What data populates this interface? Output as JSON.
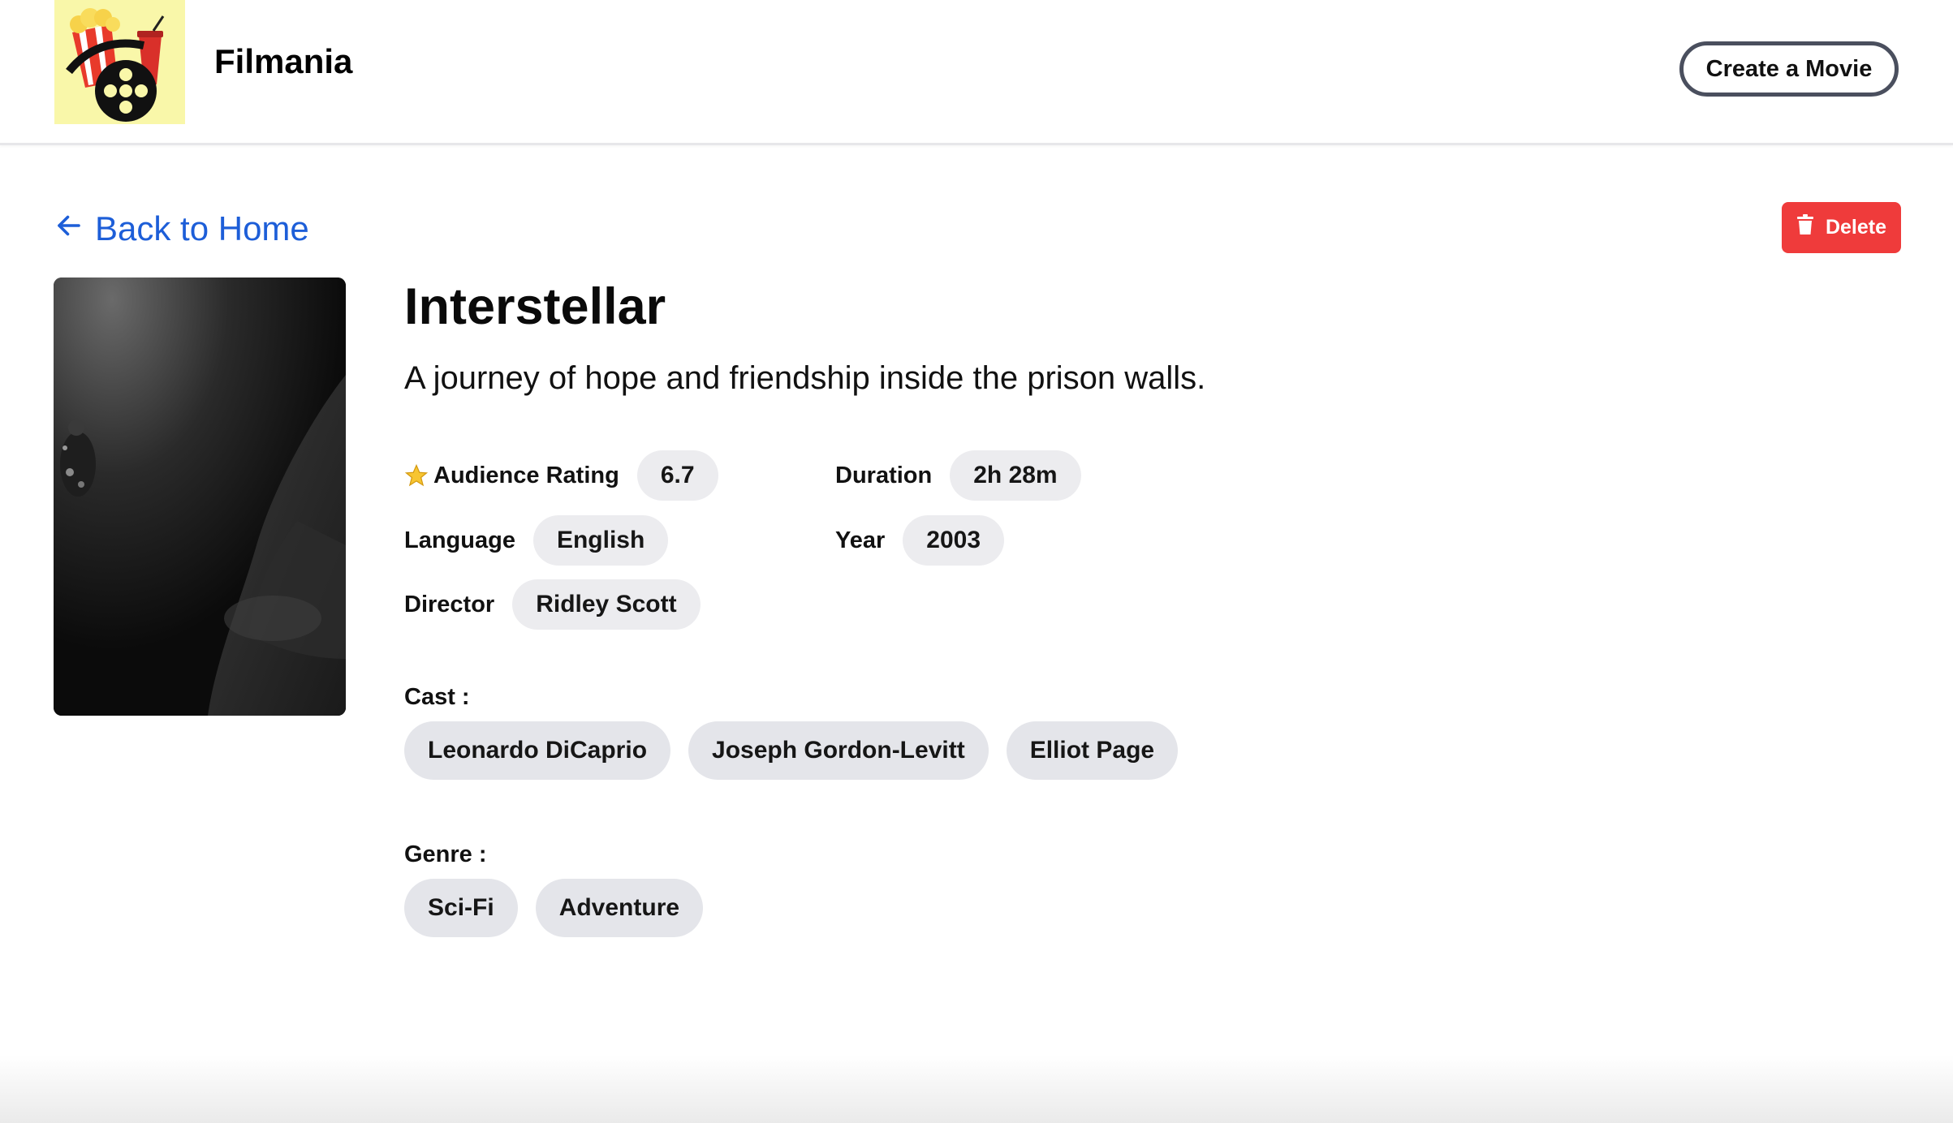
{
  "header": {
    "brand": "Filmania",
    "create_label": "Create a Movie"
  },
  "nav": {
    "back_label": "Back to Home",
    "delete_label": "Delete"
  },
  "movie": {
    "title": "Interstellar",
    "tagline": "A journey of hope and friendship inside the prison walls.",
    "rating_label": "Audience Rating",
    "rating": "6.7",
    "duration_label": "Duration",
    "duration": "2h 28m",
    "language_label": "Language",
    "language": "English",
    "year_label": "Year",
    "year": "2003",
    "director_label": "Director",
    "director": "Ridley Scott",
    "cast_label": "Cast :",
    "cast": [
      "Leonardo DiCaprio",
      "Joseph Gordon-Levitt",
      "Elliot Page"
    ],
    "genre_label": "Genre :",
    "genres": [
      "Sci-Fi",
      "Adventure"
    ]
  },
  "icons": {
    "back": "arrow-left-icon",
    "delete": "trash-icon",
    "rating": "star-icon"
  },
  "colors": {
    "link": "#1d5ed8",
    "danger": "#ef3b3b",
    "pill": "#ececef",
    "logo_bg": "#f9f7a9"
  }
}
